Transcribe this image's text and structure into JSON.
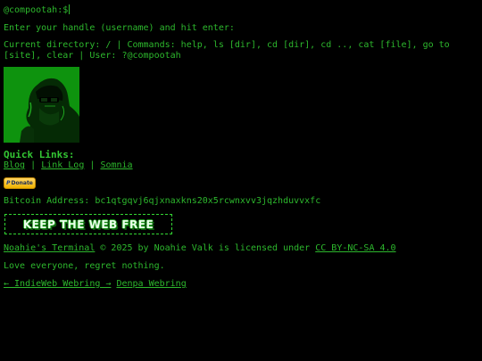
{
  "terminal": {
    "prompt": "@compootah:$",
    "instruction": "Enter your handle (username) and hit enter:",
    "status": "Current directory: / | Commands: help, ls [dir], cd [dir], cd .., cat [file], go to [site], clear | User: ?@compootah"
  },
  "quick_links": {
    "title": "Quick Links:",
    "items": [
      {
        "label": "Blog"
      },
      {
        "label": "Link Log"
      },
      {
        "label": "Somnia"
      }
    ],
    "separator": "|"
  },
  "donate": {
    "paypal_mark": "P",
    "label": "Donate"
  },
  "bitcoin": {
    "text": "Bitcoin Address: bc1qtgqvj6qjxnaxkns20x5rcwnxvv3jqzhduvvxfc"
  },
  "banner": {
    "text": "KEEP THE WEB FREE"
  },
  "license": {
    "site_link": "Noahie's Terminal",
    "middle": "© 2025 by Noahie Valk is licensed under",
    "license_link": "CC BY-NC-SA 4.0"
  },
  "motto": "Love everyone, regret nothing.",
  "webrings": {
    "indieweb": "← IndieWeb Webring →",
    "denpa": "Denpa Webring"
  },
  "colors": {
    "background": "#000000",
    "text": "#2db82d",
    "donate": "#f0b200"
  },
  "icons": {
    "avatar": "avatar-image",
    "paypal": "paypal-icon"
  }
}
